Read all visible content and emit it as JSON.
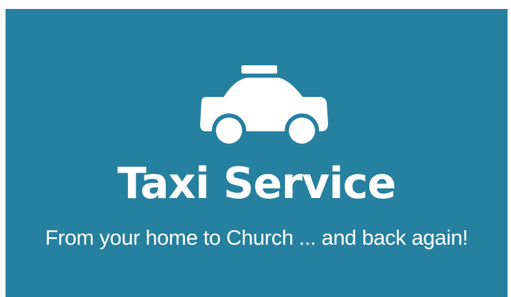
{
  "colors": {
    "background": "#26809f",
    "foreground": "#ffffff"
  },
  "icon": "taxi-car-icon",
  "title": "Taxi Service",
  "tagline": "From your home to Church ... and back again!"
}
